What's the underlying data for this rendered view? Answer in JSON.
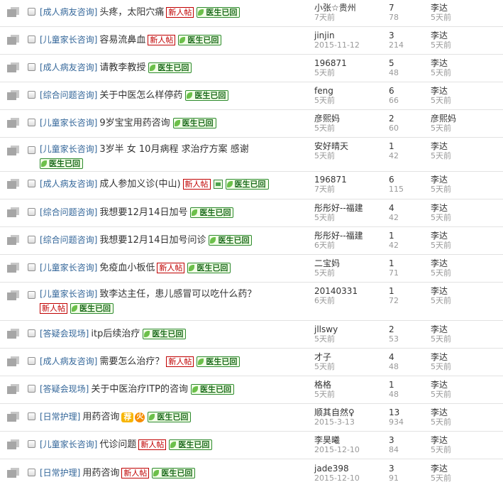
{
  "threads": [
    {
      "category": "[成人病友咨询]",
      "title": "头疼，太阳穴痛",
      "badges": [
        "new",
        "doc"
      ],
      "author": "小张☆贵州",
      "date": "7天前",
      "replies": "7",
      "views": "78",
      "last_author": "李达",
      "last_date": "5天前"
    },
    {
      "category": "[儿童家长咨询]",
      "title": "容易流鼻血",
      "badges": [
        "new",
        "doc"
      ],
      "author": "jinjin",
      "date": "2015-11-12",
      "replies": "3",
      "views": "214",
      "last_author": "李达",
      "last_date": "5天前"
    },
    {
      "category": "[成人病友咨询]",
      "title": "请教李教授",
      "badges": [
        "doc"
      ],
      "author": "196871",
      "date": "5天前",
      "replies": "5",
      "views": "48",
      "last_author": "李达",
      "last_date": "5天前"
    },
    {
      "category": "[综合问题咨询]",
      "title": "关于中医怎么样停药",
      "badges": [
        "doc"
      ],
      "author": "feng",
      "date": "5天前",
      "replies": "6",
      "views": "66",
      "last_author": "李达",
      "last_date": "5天前"
    },
    {
      "category": "[儿童家长咨询]",
      "title": "9岁宝宝用药咨询",
      "badges": [
        "doc"
      ],
      "author": "彦熙妈",
      "date": "5天前",
      "replies": "2",
      "views": "60",
      "last_author": "彦熙妈",
      "last_date": "5天前"
    },
    {
      "category": "[儿童家长咨询]",
      "title": "3岁半 女 10月病程 求治疗方案 感谢",
      "badges": [
        "doc"
      ],
      "wrap": true,
      "author": "安好晴天",
      "date": "5天前",
      "replies": "1",
      "views": "42",
      "last_author": "李达",
      "last_date": "5天前"
    },
    {
      "category": "[成人病友咨询]",
      "title": "成人参加义诊(中山)",
      "badges": [
        "new",
        "img",
        "doc"
      ],
      "author": "196871",
      "date": "7天前",
      "replies": "6",
      "views": "115",
      "last_author": "李达",
      "last_date": "5天前"
    },
    {
      "category": "[综合问题咨询]",
      "title": "我想要12月14日加号",
      "badges": [
        "doc"
      ],
      "author": "彤彤好--福建",
      "date": "5天前",
      "replies": "4",
      "views": "42",
      "last_author": "李达",
      "last_date": "5天前"
    },
    {
      "category": "[综合问题咨询]",
      "title": "我想要12月14日加号问诊",
      "badges": [
        "doc"
      ],
      "author": "彤彤好--福建",
      "date": "6天前",
      "replies": "1",
      "views": "42",
      "last_author": "李达",
      "last_date": "5天前"
    },
    {
      "category": "[儿童家长咨询]",
      "title": "免疫血小板低",
      "badges": [
        "new",
        "doc"
      ],
      "author": "二宝妈",
      "date": "5天前",
      "replies": "1",
      "views": "71",
      "last_author": "李达",
      "last_date": "5天前"
    },
    {
      "category": "[儿童家长咨询]",
      "title": "致李达主任，患儿感冒可以吃什么药？",
      "badges": [
        "new",
        "doc"
      ],
      "wrap": true,
      "author": "20140331",
      "date": "6天前",
      "replies": "1",
      "views": "72",
      "last_author": "李达",
      "last_date": "5天前"
    },
    {
      "category": "[答疑会现场]",
      "title": "itp后续治疗",
      "badges": [
        "doc"
      ],
      "author": "jllswy",
      "date": "5天前",
      "replies": "2",
      "views": "53",
      "last_author": "李达",
      "last_date": "5天前"
    },
    {
      "category": "[成人病友咨询]",
      "title": "需要怎么治疗？",
      "badges": [
        "new",
        "doc"
      ],
      "author": "才子",
      "date": "5天前",
      "replies": "4",
      "views": "48",
      "last_author": "李达",
      "last_date": "5天前"
    },
    {
      "category": "[答疑会现场]",
      "title": "关于中医治疗ITP的咨询",
      "badges": [
        "doc"
      ],
      "author": "格格",
      "date": "5天前",
      "replies": "1",
      "views": "48",
      "last_author": "李达",
      "last_date": "5天前"
    },
    {
      "category": "[日常护理]",
      "title": "用药咨询",
      "badges": [
        "jian",
        "huo",
        "doc"
      ],
      "author": "顺其自然♀",
      "date": "2015-3-13",
      "replies": "13",
      "views": "934",
      "last_author": "李达",
      "last_date": "5天前"
    },
    {
      "category": "[儿童家长咨询]",
      "title": "代诊问题",
      "badges": [
        "new",
        "doc"
      ],
      "author": "李昊曦",
      "date": "2015-12-10",
      "replies": "3",
      "views": "84",
      "last_author": "李达",
      "last_date": "5天前"
    },
    {
      "category": "[日常护理]",
      "title": "用药咨询",
      "badges": [
        "new",
        "doc"
      ],
      "author": "jade398",
      "date": "2015-12-10",
      "replies": "3",
      "views": "91",
      "last_author": "李达",
      "last_date": "5天前"
    }
  ],
  "labels": {
    "new": "新人帖",
    "doc": "医生已回",
    "jian": "荐",
    "huo": "火"
  },
  "colors": {
    "category": "#336699",
    "new_badge": "#c00000",
    "doc_badge": "#2e8a2e",
    "meta_gray": "#999999"
  }
}
